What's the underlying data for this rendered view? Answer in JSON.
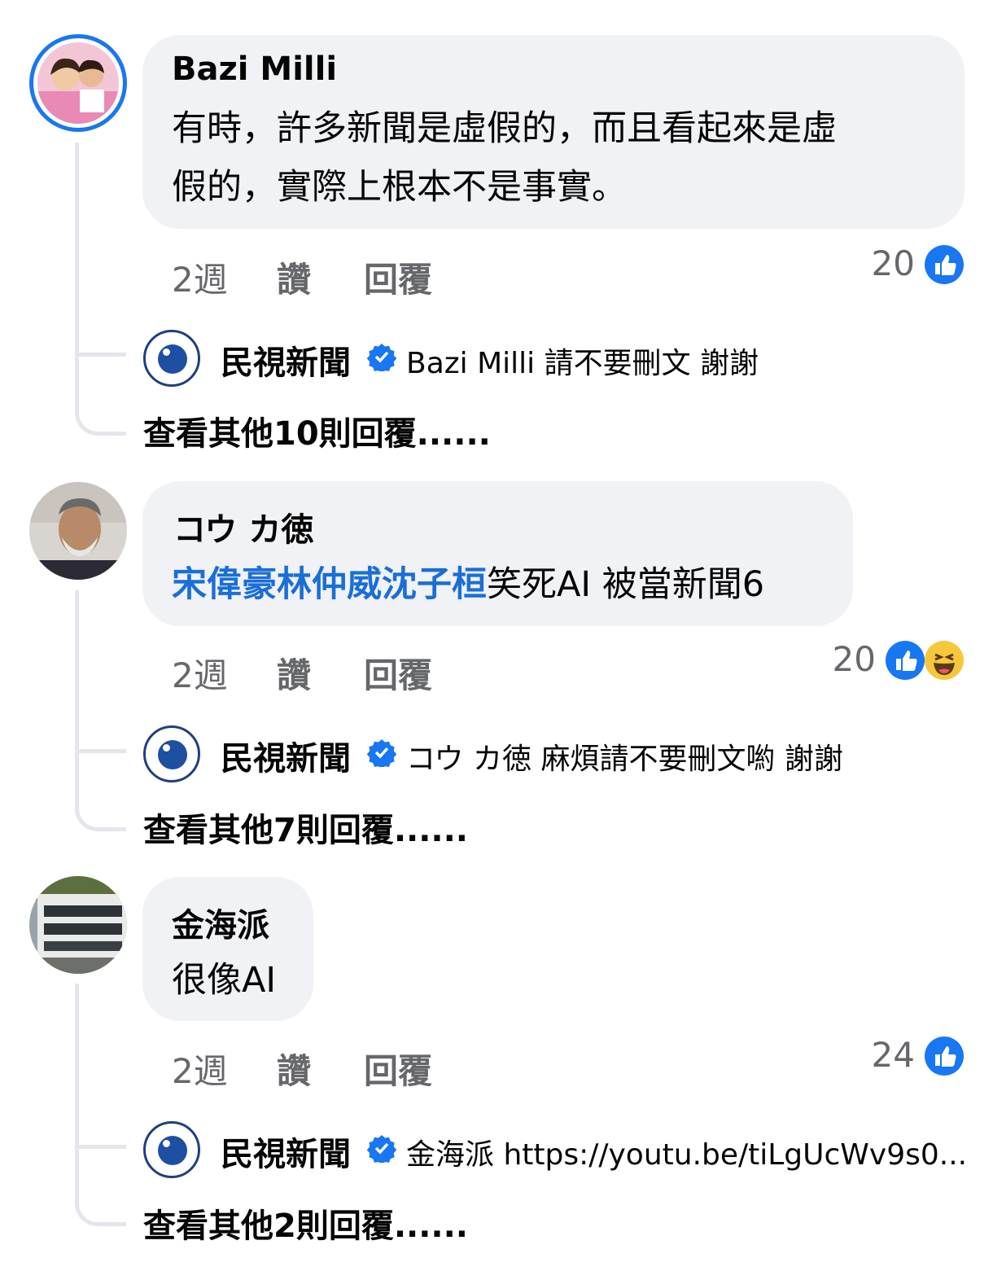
{
  "comments": [
    {
      "author": "Bazi Milli",
      "text_lines": [
        "有時，許多新聞是虛假的，而且看起來是虛",
        "假的，實際上根本不是事實。"
      ],
      "time": "2週",
      "like_label": "讚",
      "reply_label": "回覆",
      "reaction_count": "20",
      "reactions": [
        "like-icon"
      ],
      "reply": {
        "author": "民視新聞",
        "verified": true,
        "text": "Bazi Milli 請不要刪文 謝謝"
      },
      "more_replies": "查看其他10則回覆......"
    },
    {
      "author": "コウ カ徳",
      "mention": "宋偉豪林仲威沈子桓",
      "text": "笑死AI 被當新聞6",
      "time": "2週",
      "like_label": "讚",
      "reply_label": "回覆",
      "reaction_count": "20",
      "reactions": [
        "like-icon",
        "haha-icon"
      ],
      "reply": {
        "author": "民視新聞",
        "verified": true,
        "text": "コウ カ徳 麻煩請不要刪文喲 謝謝"
      },
      "more_replies": "查看其他7則回覆......"
    },
    {
      "author": "金海派",
      "text": "很像AI",
      "time": "2週",
      "like_label": "讚",
      "reply_label": "回覆",
      "reaction_count": "24",
      "reactions": [
        "like-icon"
      ],
      "reply": {
        "author": "民視新聞",
        "verified": true,
        "text": "金海派 https://youtu.be/tiLgUcWv9s0..."
      },
      "more_replies": "查看其他2則回覆......"
    }
  ],
  "colors": {
    "accent": "#1877f2",
    "bubble": "#f0f2f5",
    "meta": "#65676b",
    "mention": "#1a6ed8"
  }
}
